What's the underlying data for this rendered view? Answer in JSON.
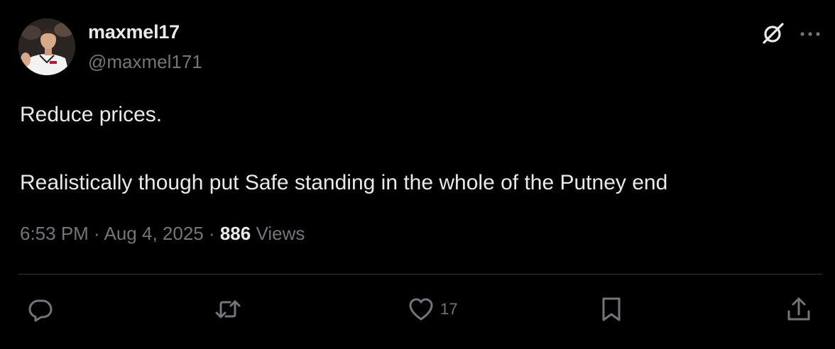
{
  "author": {
    "display_name": "maxmel17",
    "handle": "@maxmel171"
  },
  "tweet": {
    "paragraphs": [
      "Reduce prices.",
      "Realistically though put Safe standing in the whole of the Putney end"
    ]
  },
  "meta": {
    "time": "6:53 PM",
    "separator": " · ",
    "date": "Aug 4, 2025",
    "views_count": "886",
    "views_label": " Views"
  },
  "actions": {
    "reply_count": "",
    "retweet_count": "",
    "like_count": "17",
    "bookmark_count": ""
  },
  "icons": {
    "grok": "grok-icon",
    "more": "more-icon",
    "reply": "reply-icon",
    "retweet": "retweet-icon",
    "like": "heart-icon",
    "bookmark": "bookmark-icon",
    "share": "share-icon"
  },
  "colors": {
    "background": "#000000",
    "primary_text": "#e7e9ea",
    "secondary_text": "#71767b",
    "divider": "#2f3336"
  }
}
